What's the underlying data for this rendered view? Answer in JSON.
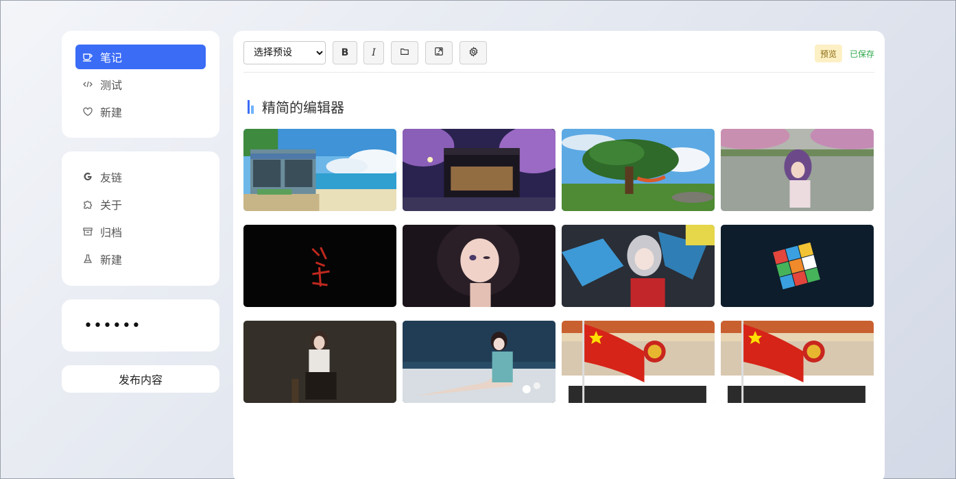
{
  "colors": {
    "accent": "#3b6cf6",
    "preview_bg": "#fdf0c4",
    "saved": "#2ea84a"
  },
  "sidebar": {
    "primary": [
      {
        "label": "笔记",
        "icon": "cup-icon",
        "active": true
      },
      {
        "label": "测试",
        "icon": "code-icon",
        "active": false
      },
      {
        "label": "新建",
        "icon": "heart-icon",
        "active": false
      }
    ],
    "secondary": [
      {
        "label": "友链",
        "icon": "google-icon"
      },
      {
        "label": "关于",
        "icon": "puzzle-icon"
      },
      {
        "label": "归档",
        "icon": "archive-icon"
      },
      {
        "label": "新建",
        "icon": "flask-icon"
      }
    ],
    "password_value": "••••••",
    "publish_label": "发布内容"
  },
  "toolbar": {
    "preset_selected": "选择预设",
    "bold_label": "B",
    "italic_label": "I",
    "preview_label": "预览",
    "saved_label": "已保存"
  },
  "editor": {
    "title": "精简的编辑器"
  },
  "gallery": {
    "images": [
      "pixel-art-seaside-cafe",
      "night-cafe-cherry-blossoms",
      "pixel-tree-hammock-meadow",
      "anime-girl-lake-blossoms",
      "red-calligraphy-black",
      "anime-girl-dark-hair",
      "anime-girl-graffiti-wall",
      "rubiks-cube-dark",
      "woman-seated-dark-room",
      "woman-lying-on-beach",
      "red-flag-building",
      "red-flag-building"
    ]
  }
}
